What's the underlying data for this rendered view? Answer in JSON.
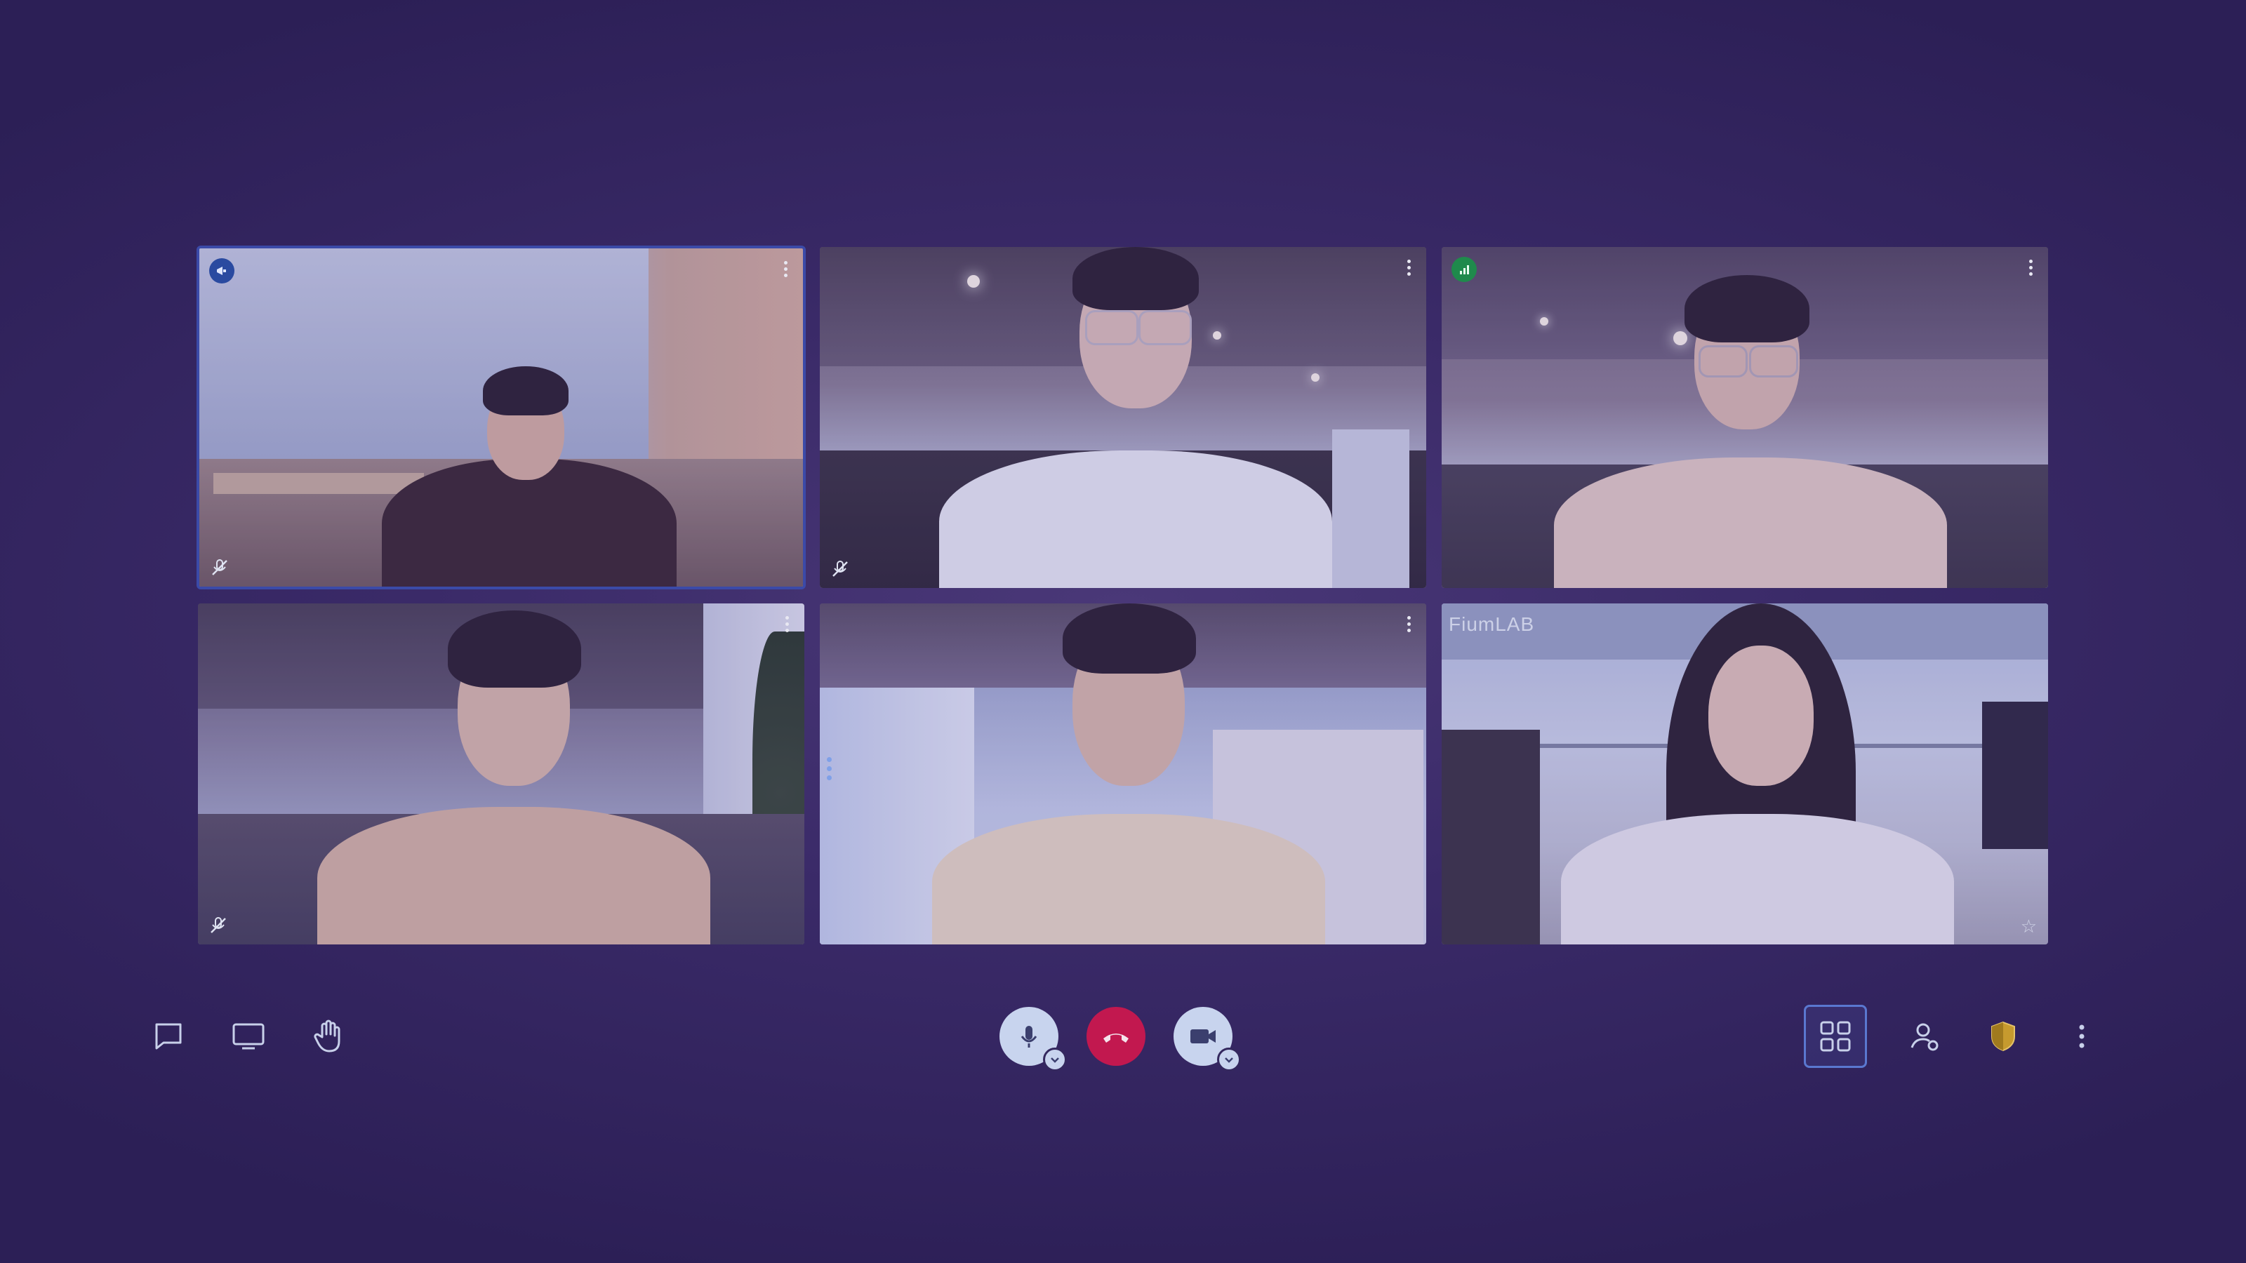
{
  "meeting": {
    "participants": [
      {
        "id": "p1",
        "active_speaker": true,
        "muted": true,
        "badge": "megaphone-icon",
        "scene": "office-curtain"
      },
      {
        "id": "p2",
        "active_speaker": false,
        "muted": true,
        "badge": null,
        "scene": "office-ceiling-lights"
      },
      {
        "id": "p3",
        "active_speaker": false,
        "muted": false,
        "badge": "signal-bars-icon",
        "scene": "office-ceiling-lights"
      },
      {
        "id": "p4",
        "active_speaker": false,
        "muted": true,
        "badge": null,
        "scene": "office-corner-plant"
      },
      {
        "id": "p5",
        "active_speaker": false,
        "muted": false,
        "badge": null,
        "scene": "whiteboard-window"
      },
      {
        "id": "p6",
        "active_speaker": false,
        "muted": false,
        "badge": null,
        "scene": "office-glass-wall",
        "wall_text": "FiumLAB",
        "pinned": true
      }
    ]
  },
  "toolbar": {
    "left": [
      "chat-icon",
      "screen-share-icon",
      "raise-hand-icon"
    ],
    "center": [
      "microphone-icon",
      "hang-up-icon",
      "camera-icon"
    ],
    "right": [
      "grid-view-icon",
      "participants-icon",
      "security-shield-icon",
      "more-options-icon"
    ]
  },
  "colors": {
    "background": "#3a2a68",
    "active_border": "#3b4aa8",
    "hangup_red": "#c2184f",
    "control_light": "#c8d4ee",
    "grid_view_accent": "#5a78d0",
    "badge_green": "#1f8a4c",
    "badge_blue": "#2a4aa0",
    "shield_gold": "#c69a2e"
  }
}
